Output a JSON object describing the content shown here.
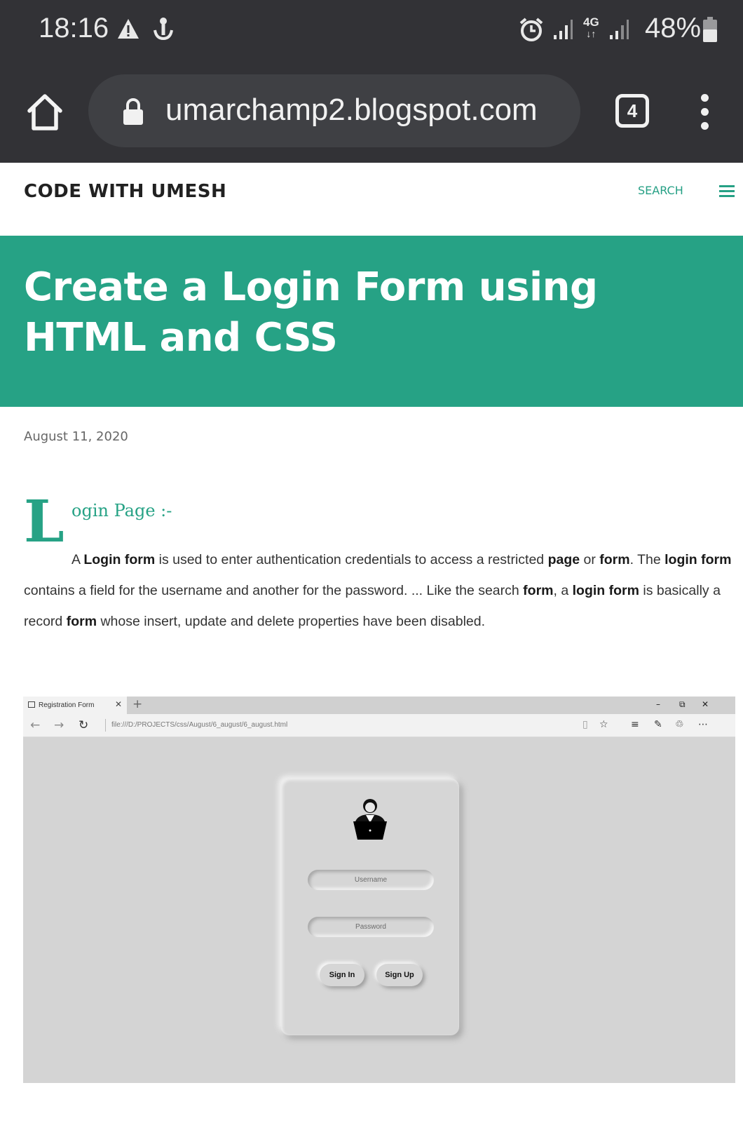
{
  "status_bar": {
    "time": "18:16",
    "network": "4G",
    "battery_percent": "48%",
    "icons": [
      "warning-icon",
      "anchor-icon",
      "alarm-icon",
      "signal-icon",
      "signal-icon",
      "battery-icon"
    ]
  },
  "browser": {
    "url": "umarchamp2.blogspot.com",
    "tab_count": "4"
  },
  "blog": {
    "name": "CODE WITH UMESH",
    "search_label": "SEARCH"
  },
  "post": {
    "title": "Create a Login Form using HTML and CSS",
    "date": "August 11, 2020",
    "dropcap": "L",
    "subheading": "ogin Page :-",
    "paragraph": [
      {
        "text": "A ",
        "bold": false
      },
      {
        "text": "Login form",
        "bold": true
      },
      {
        "text": " is used to enter authentication credentials to access a restricted ",
        "bold": false
      },
      {
        "text": "page",
        "bold": true
      },
      {
        "text": " or ",
        "bold": false
      },
      {
        "text": "form",
        "bold": true
      },
      {
        "text": ". The ",
        "bold": false
      },
      {
        "text": "login form",
        "bold": true
      },
      {
        "text": " contains a field for the username and another for the password. ... Like the search ",
        "bold": false
      },
      {
        "text": "form",
        "bold": true
      },
      {
        "text": ", a ",
        "bold": false
      },
      {
        "text": "login form",
        "bold": true
      },
      {
        "text": " is basically a record ",
        "bold": false
      },
      {
        "text": "form",
        "bold": true
      },
      {
        "text": " whose insert, update and delete properties have been disabled.",
        "bold": false
      }
    ]
  },
  "embedded_screenshot": {
    "tab_title": "Registration Form",
    "new_tab": "+",
    "window_controls": [
      "–",
      "⧉",
      "✕"
    ],
    "url": "file:///D:/PROJECTS/css/August/6_august/6_august.html",
    "form": {
      "username_placeholder": "Username",
      "password_placeholder": "Password",
      "signin_label": "Sign In",
      "signup_label": "Sign Up"
    }
  },
  "colors": {
    "accent": "#26a285",
    "status_bar_bg": "#323236",
    "url_pill_bg": "#3f4044",
    "embedded_bg": "#d4d4d4"
  }
}
